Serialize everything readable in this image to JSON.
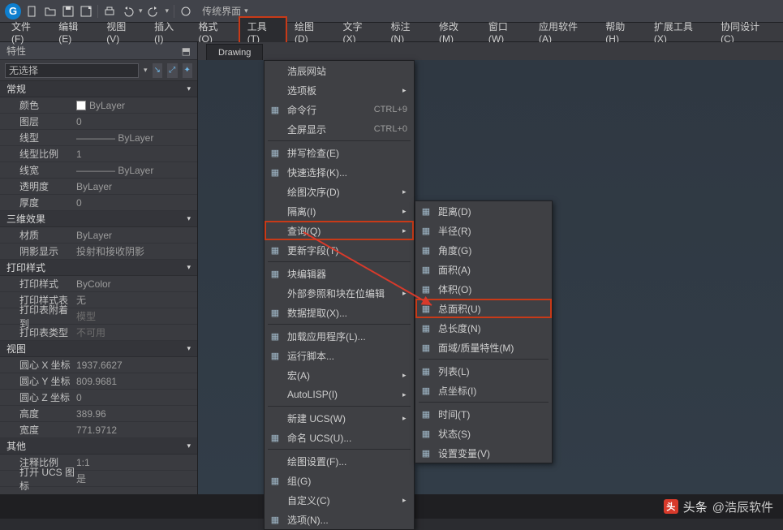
{
  "titlebar": {
    "ui_style": "传统界面"
  },
  "menubar": {
    "items": [
      {
        "label": "文件(F)"
      },
      {
        "label": "编辑(E)"
      },
      {
        "label": "视图(V)"
      },
      {
        "label": "插入(I)"
      },
      {
        "label": "格式(O)"
      },
      {
        "label": "工具(T)",
        "active": true
      },
      {
        "label": "绘图(D)"
      },
      {
        "label": "文字(X)"
      },
      {
        "label": "标注(N)"
      },
      {
        "label": "修改(M)"
      },
      {
        "label": "窗口(W)"
      },
      {
        "label": "应用软件(A)"
      },
      {
        "label": "帮助(H)"
      },
      {
        "label": "扩展工具(X)"
      },
      {
        "label": "协同设计(C)"
      }
    ]
  },
  "properties": {
    "panel_title": "特性",
    "selector": "无选择",
    "sections": {
      "general": {
        "title": "常规",
        "rows": [
          {
            "label": "颜色",
            "value": "ByLayer",
            "swatch": true
          },
          {
            "label": "图层",
            "value": "0"
          },
          {
            "label": "线型",
            "value": "———— ByLayer"
          },
          {
            "label": "线型比例",
            "value": "1"
          },
          {
            "label": "线宽",
            "value": "———— ByLayer"
          },
          {
            "label": "透明度",
            "value": "ByLayer"
          },
          {
            "label": "厚度",
            "value": "0"
          }
        ]
      },
      "threeD": {
        "title": "三维效果",
        "rows": [
          {
            "label": "材质",
            "value": "ByLayer"
          },
          {
            "label": "阴影显示",
            "value": "投射和接收阴影"
          }
        ]
      },
      "plot": {
        "title": "打印样式",
        "rows": [
          {
            "label": "打印样式",
            "value": "ByColor"
          },
          {
            "label": "打印样式表",
            "value": "无"
          },
          {
            "label": "打印表附着到",
            "value": "模型",
            "grey": true
          },
          {
            "label": "打印表类型",
            "value": "不可用",
            "grey": true
          }
        ]
      },
      "view": {
        "title": "视图",
        "rows": [
          {
            "label": "圆心 X 坐标",
            "value": "1937.6627"
          },
          {
            "label": "圆心 Y 坐标",
            "value": "809.9681"
          },
          {
            "label": "圆心 Z 坐标",
            "value": "0"
          },
          {
            "label": "高度",
            "value": "389.96"
          },
          {
            "label": "宽度",
            "value": "771.9712"
          }
        ]
      },
      "other": {
        "title": "其他",
        "rows": [
          {
            "label": "注释比例",
            "value": "1:1"
          },
          {
            "label": "打开 UCS 图标",
            "value": "是"
          }
        ]
      }
    }
  },
  "document": {
    "tab": "Drawing"
  },
  "tools_menu": {
    "items": [
      {
        "label": "浩辰网站"
      },
      {
        "label": "选项板",
        "sub": true
      },
      {
        "label": "命令行",
        "accel": "CTRL+9",
        "icon": "cmd"
      },
      {
        "label": "全屏显示",
        "accel": "CTRL+0"
      },
      {
        "sep": true
      },
      {
        "label": "拼写检查(E)",
        "icon": "abc"
      },
      {
        "label": "快速选择(K)...",
        "icon": "sel"
      },
      {
        "label": "绘图次序(D)",
        "sub": true
      },
      {
        "label": "隔离(I)",
        "sub": true
      },
      {
        "label": "查询(Q)",
        "sub": true,
        "boxed": true
      },
      {
        "label": "更新字段(T)",
        "icon": "upd"
      },
      {
        "sep": true
      },
      {
        "label": "块编辑器",
        "icon": "blk"
      },
      {
        "label": "外部参照和块在位编辑",
        "sub": true
      },
      {
        "label": "数据提取(X)...",
        "icon": "data"
      },
      {
        "sep": true
      },
      {
        "label": "加载应用程序(L)...",
        "icon": "load"
      },
      {
        "label": "运行脚本...",
        "icon": "run"
      },
      {
        "label": "宏(A)",
        "sub": true
      },
      {
        "label": "AutoLISP(I)",
        "sub": true
      },
      {
        "sep": true
      },
      {
        "label": "新建 UCS(W)",
        "sub": true
      },
      {
        "label": "命名 UCS(U)...",
        "icon": "ucs"
      },
      {
        "sep": true
      },
      {
        "label": "绘图设置(F)..."
      },
      {
        "label": "组(G)",
        "icon": "grp"
      },
      {
        "label": "自定义(C)",
        "sub": true
      },
      {
        "label": "选项(N)...",
        "icon": "opt"
      }
    ]
  },
  "query_submenu": {
    "items": [
      {
        "label": "距离(D)",
        "icon": "dist"
      },
      {
        "label": "半径(R)",
        "icon": "rad"
      },
      {
        "label": "角度(G)",
        "icon": "ang"
      },
      {
        "label": "面积(A)",
        "icon": "area"
      },
      {
        "label": "体积(O)",
        "icon": "vol"
      },
      {
        "label": "总面积(U)",
        "icon": "tarea",
        "boxed": true
      },
      {
        "label": "总长度(N)",
        "icon": "tlen"
      },
      {
        "label": "面域/质量特性(M)",
        "icon": "mass"
      },
      {
        "sep": true
      },
      {
        "label": "列表(L)",
        "icon": "list"
      },
      {
        "label": "点坐标(I)",
        "icon": "pt"
      },
      {
        "sep": true
      },
      {
        "label": "时间(T)",
        "icon": "time"
      },
      {
        "label": "状态(S)",
        "icon": "stat"
      },
      {
        "label": "设置变量(V)",
        "icon": "var"
      }
    ]
  },
  "footer": {
    "brand": "头条",
    "author": "@浩辰软件"
  }
}
